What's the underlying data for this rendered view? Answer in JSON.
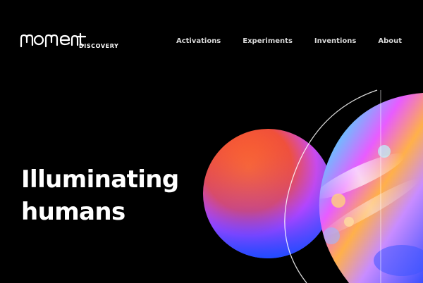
{
  "brand": {
    "logo_wordmark": "moment",
    "logo_sub": "DISCOVERY"
  },
  "nav": {
    "items": [
      {
        "label": "Activations"
      },
      {
        "label": "Experiments"
      },
      {
        "label": "Inventions"
      },
      {
        "label": "About"
      }
    ]
  },
  "hero": {
    "headline_line1": "Illuminating",
    "headline_line2": "humans"
  },
  "colors": {
    "background": "#000000",
    "text": "#ffffff",
    "nav_text": "#d8d8d8",
    "orb_warm": "#ff5a2a",
    "orb_cool": "#2f5cff",
    "orb_magenta": "#c64aff",
    "lens_cyan": "#3fe0ff"
  }
}
